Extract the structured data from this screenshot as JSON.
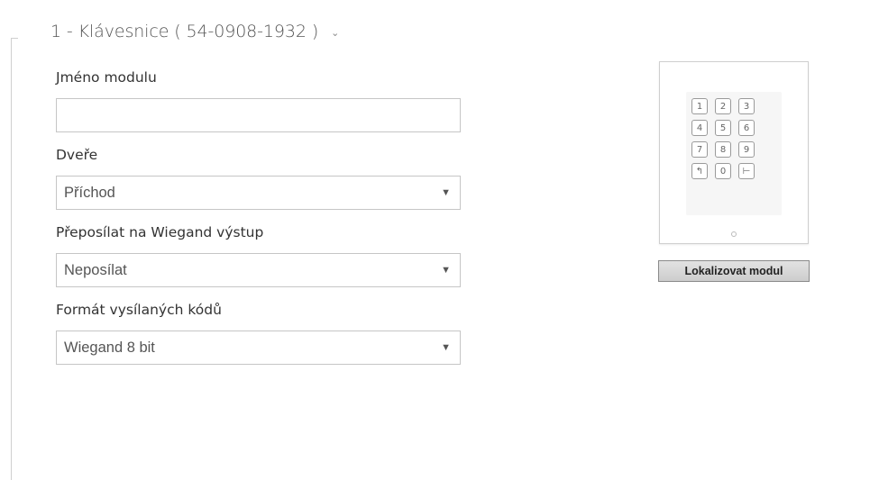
{
  "section": {
    "title": "1 - Klávesnice ( 54-0908-1932 )",
    "chevron_icon": "chevron-down-icon"
  },
  "fields": {
    "module_name": {
      "label": "Jméno modulu",
      "value": ""
    },
    "door": {
      "label": "Dveře",
      "value": "Příchod"
    },
    "wiegand_forward": {
      "label": "Přeposílat na Wiegand výstup",
      "value": "Neposílat"
    },
    "code_format": {
      "label": "Formát vysílaných kódů",
      "value": "Wiegand 8 bit"
    }
  },
  "device": {
    "keys": [
      "1",
      "2",
      "3",
      "4",
      "5",
      "6",
      "7",
      "8",
      "9",
      "↰",
      "0",
      "⊢"
    ]
  },
  "locate_button": {
    "label": "Lokalizovat modul"
  }
}
